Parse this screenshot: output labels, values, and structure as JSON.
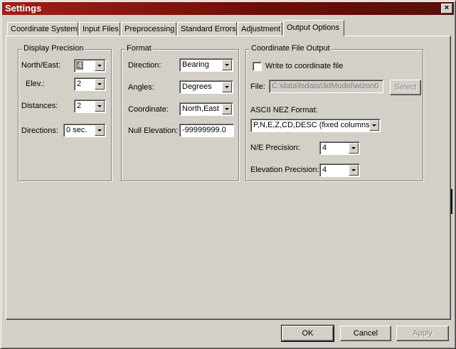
{
  "window": {
    "title": "Settings",
    "close_glyph": "×"
  },
  "tabs": [
    "Coordinate System",
    "Input Files",
    "Preprocessing",
    "Standard Errors",
    "Adjustment",
    "Output Options"
  ],
  "active_tab": "Output Options",
  "display_precision": {
    "legend": "Display Precision",
    "north_east": {
      "label": "North/East:",
      "value": "4"
    },
    "elev": {
      "label": "Elev.:",
      "value": "2"
    },
    "distances": {
      "label": "Distances:",
      "value": "2"
    },
    "directions": {
      "label": "Directions:",
      "value": "0 sec."
    }
  },
  "format": {
    "legend": "Format",
    "direction": {
      "label": "Direction:",
      "value": "Bearing"
    },
    "angles": {
      "label": "Angles:",
      "value": "Degrees"
    },
    "coordinate": {
      "label": "Coordinate:",
      "value": "North,East"
    },
    "null_elevation": {
      "label": "Null Elevation:",
      "value": "-99999999.0"
    }
  },
  "coordinate_file_output": {
    "legend": "Coordinate File Output",
    "write_checkbox": {
      "label": "Write to coordinate file",
      "checked": false
    },
    "file": {
      "label": "File:",
      "value": "C:\\data\\lsdata\\3dModel\\wizon0",
      "select_label": "Select"
    },
    "ascii_nez": {
      "label": "ASCII NEZ Format:",
      "value": "P,N,E,Z,CD,DESC (fixed columns)"
    },
    "ne_precision": {
      "label": "N/E Precision:",
      "value": "4"
    },
    "elevation_precision": {
      "label": "Elevation Precision:",
      "value": "4"
    }
  },
  "buttons": {
    "ok": "OK",
    "cancel": "Cancel",
    "apply": "Apply"
  },
  "colors": {
    "face": "#d4d0c8",
    "title_start": "#a11f16",
    "title_end": "#58100b"
  }
}
